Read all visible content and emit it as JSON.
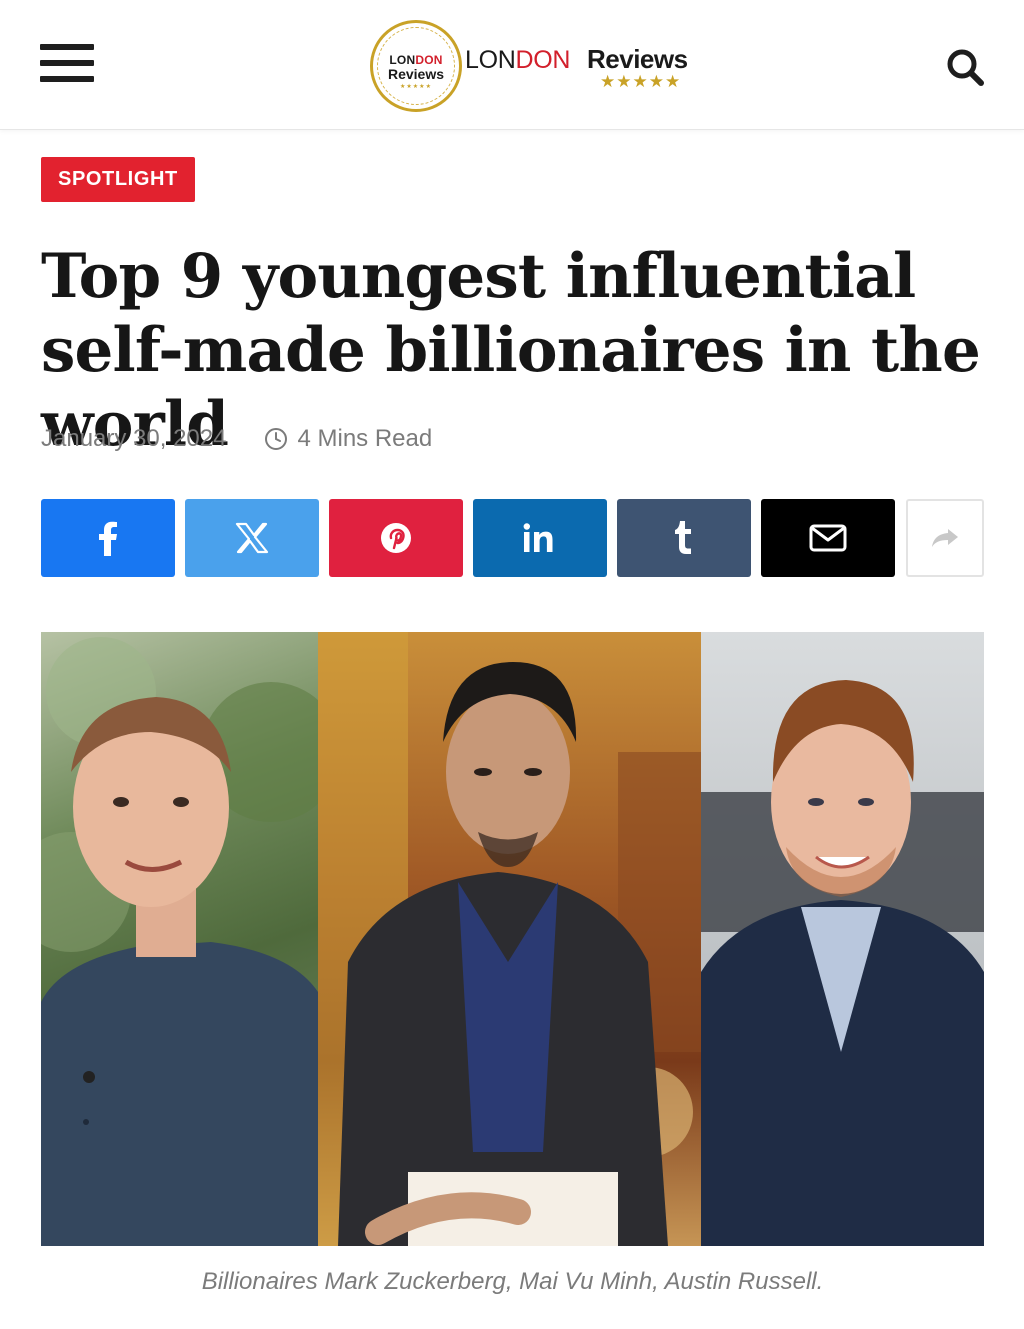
{
  "header": {
    "menu_icon": "hamburger-menu-icon",
    "logo": {
      "badge_line1_a": "LON",
      "badge_line1_b": "DON",
      "badge_line2": "Reviews",
      "badge_stars": "★★★★★",
      "word_london_a": "LON",
      "word_london_b": "DON",
      "word_reviews": "Reviews",
      "stars": "★★★★★"
    },
    "search_icon": "search-icon"
  },
  "article": {
    "category": "SPOTLIGHT",
    "title": "Top 9 youngest influential self-made billionaires in the world",
    "date": "January 30, 2024",
    "read_time": "4 Mins Read"
  },
  "share": [
    {
      "network": "facebook",
      "icon": "facebook-icon",
      "color": "#1877f2"
    },
    {
      "network": "x",
      "icon": "x-icon",
      "color": "#4aa1ec"
    },
    {
      "network": "pinterest",
      "icon": "pinterest-icon",
      "color": "#e0213f"
    },
    {
      "network": "linkedin",
      "icon": "linkedin-icon",
      "color": "#0b6aaf"
    },
    {
      "network": "tumblr",
      "icon": "tumblr-icon",
      "color": "#3e5472"
    },
    {
      "network": "email",
      "icon": "mail-icon",
      "color": "#000000"
    },
    {
      "network": "more",
      "icon": "share-arrow-icon",
      "color": "#ffffff"
    }
  ],
  "featured_image": {
    "caption": "Billionaires Mark Zuckerberg, Mai Vu Minh, Austin Russell."
  },
  "colors": {
    "accent_red": "#e2222f",
    "logo_gold": "#c9a227",
    "meta_gray": "#7b7b7b"
  }
}
